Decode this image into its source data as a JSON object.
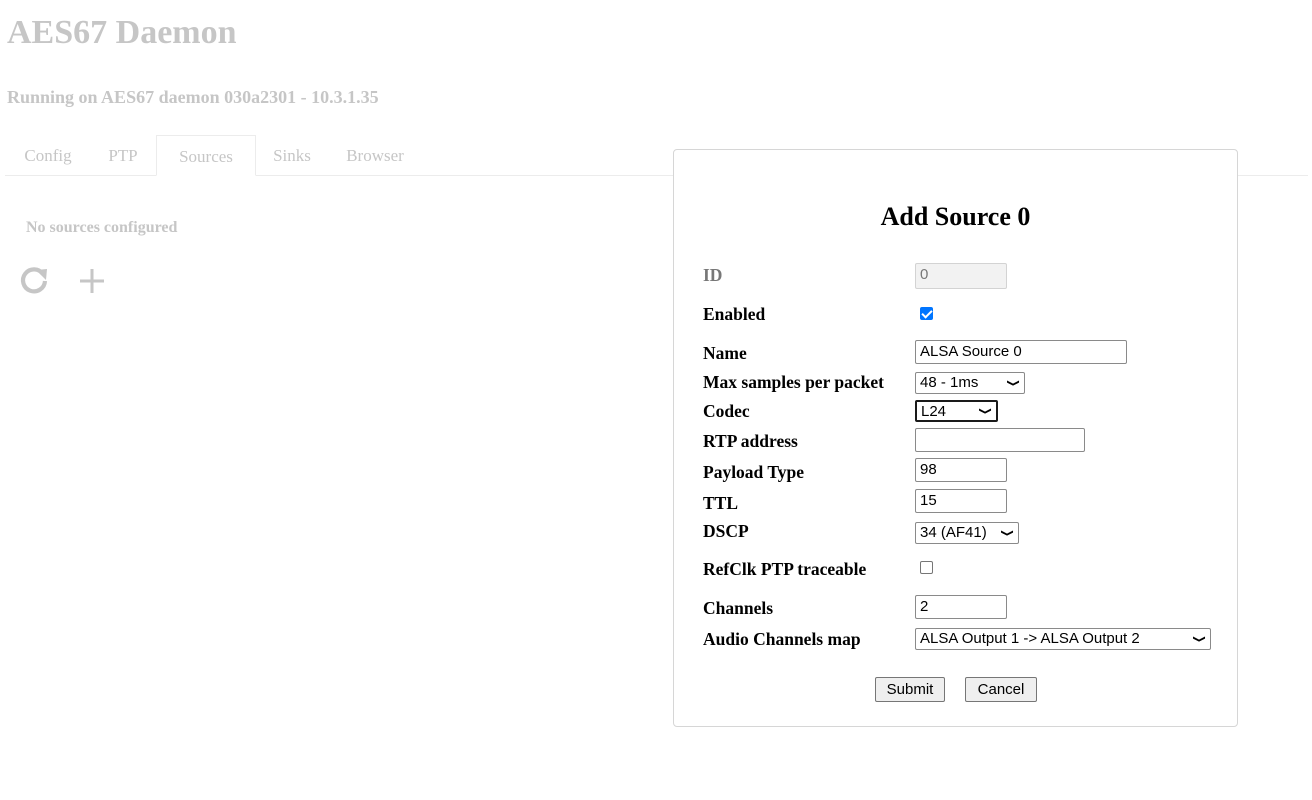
{
  "app": {
    "title": "AES67 Daemon",
    "subtitle": "Running on AES67 daemon 030a2301 - 10.3.1.35"
  },
  "tabs": [
    {
      "label": "Config"
    },
    {
      "label": "PTP"
    },
    {
      "label": "Sources",
      "active": true
    },
    {
      "label": "Sinks"
    },
    {
      "label": "Browser"
    }
  ],
  "sources": {
    "empty_message": "No sources configured",
    "icons": [
      "refresh-icon",
      "plus-icon"
    ]
  },
  "modal": {
    "title": "Add Source 0",
    "fields": {
      "id": {
        "label": "ID",
        "value": "0"
      },
      "enabled": {
        "label": "Enabled",
        "checked": true
      },
      "name": {
        "label": "Name",
        "value": "ALSA Source 0"
      },
      "max_samples": {
        "label": "Max samples per packet",
        "value": "48 - 1ms"
      },
      "codec": {
        "label": "Codec",
        "value": "L24"
      },
      "rtp_address": {
        "label": "RTP address",
        "value": ""
      },
      "payload_type": {
        "label": "Payload Type",
        "value": "98"
      },
      "ttl": {
        "label": "TTL",
        "value": "15"
      },
      "dscp": {
        "label": "DSCP",
        "value": "34 (AF41)"
      },
      "refclk": {
        "label": "RefClk PTP traceable",
        "checked": false
      },
      "channels": {
        "label": "Channels",
        "value": "2"
      },
      "audio_map": {
        "label": "Audio Channels map",
        "value": "ALSA Output 1 -> ALSA Output 2"
      }
    },
    "buttons": {
      "submit": "Submit",
      "cancel": "Cancel"
    }
  },
  "colors": {
    "muted_text": "#c6c6c6",
    "checkbox_accent": "#0075ff",
    "border": "#d6d6d6"
  }
}
